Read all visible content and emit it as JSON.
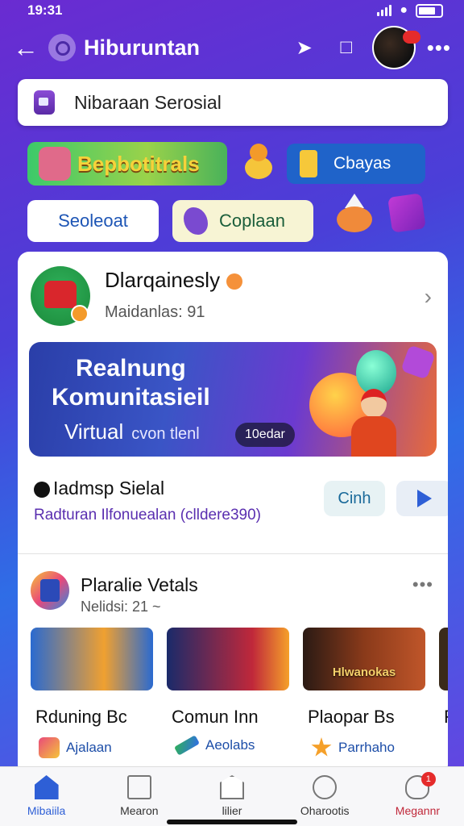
{
  "status": {
    "time": "19:31"
  },
  "header": {
    "title": "Hiburuntan"
  },
  "search": {
    "text": "Nibaraan Serosial"
  },
  "chips": [
    {
      "label": "Bepbotitrals"
    },
    {
      "label": "Cbayas"
    },
    {
      "label": "Seoleoat"
    },
    {
      "label": "Coplaan"
    }
  ],
  "card": {
    "profile": {
      "name": "Dlarqainesly",
      "subtitle": "Maidanlas: 91"
    },
    "banner": {
      "line1": "Realnung",
      "line2": "Komunitasieil",
      "line3": "Virtual",
      "line3_small": "cvon tlenl",
      "badge": "10edar"
    },
    "post": {
      "title": "Iadmsp Sielal",
      "subtitle": "Radturan Ilfonuealan (clldere390)",
      "button": "Cinh"
    },
    "section": {
      "title": "Plaralie Vetals",
      "subtitle": "Nelidsi: 21 ~",
      "items": [
        {
          "image_text": "",
          "title": "Rduning Bc",
          "tag": "Ajalaan"
        },
        {
          "image_text": "",
          "title": "Comun Inn",
          "tag": "Aeolabs"
        },
        {
          "image_text": "Hlwanokas",
          "title": "Plaopar Bs",
          "tag": "Parrhaho"
        },
        {
          "image_text": "",
          "title": "F",
          "tag": ""
        }
      ]
    }
  },
  "bottom_nav": [
    {
      "label": "Mibaiila",
      "icon": "home-icon"
    },
    {
      "label": "Mearon",
      "icon": "message-icon"
    },
    {
      "label": "lilier",
      "icon": "library-icon"
    },
    {
      "label": "Oharootis",
      "icon": "search-face-icon"
    },
    {
      "label": "Megannr",
      "icon": "profile-icon",
      "badge": "1"
    }
  ]
}
